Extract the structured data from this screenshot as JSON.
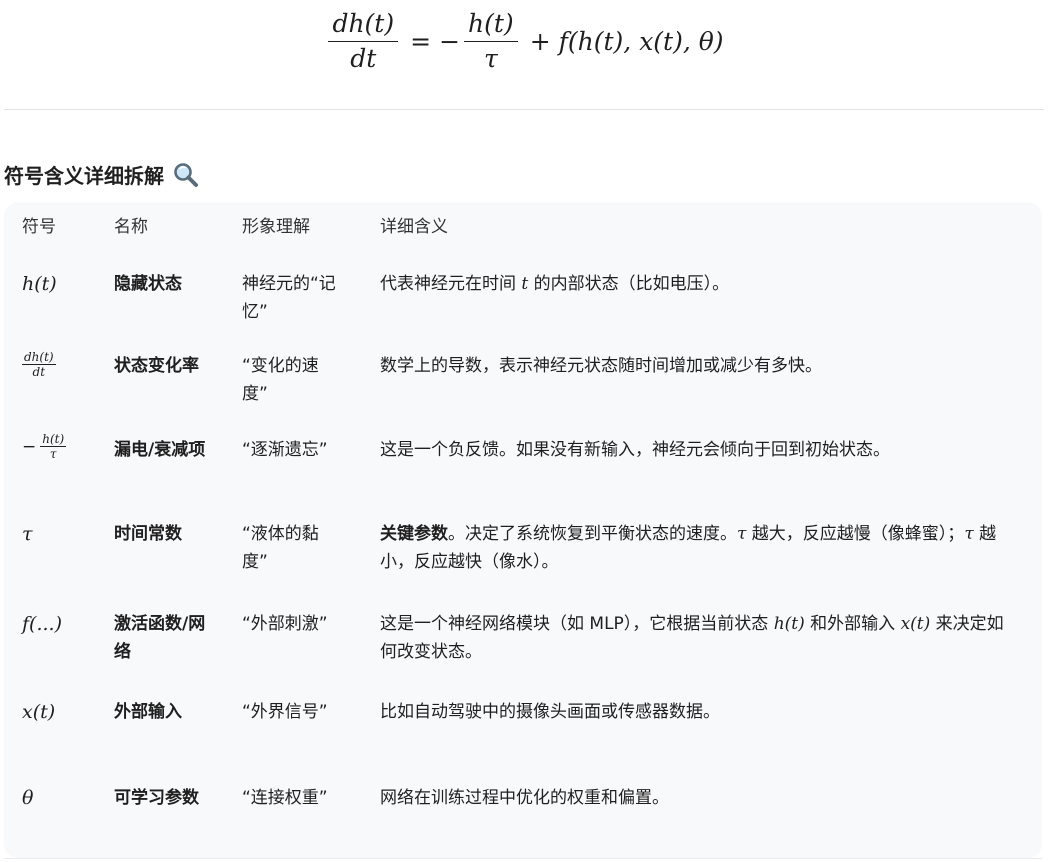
{
  "equation": {
    "lhs_num": "dh(t)",
    "lhs_den": "dt",
    "equals": "=",
    "minus": "−",
    "frac2_num": "h(t)",
    "frac2_den": "τ",
    "plus": "+",
    "rhs": "f(h(t), x(t), θ)"
  },
  "section": {
    "heading": "符号含义详细拆解",
    "icon": "magnifier-icon"
  },
  "table": {
    "headers": [
      "符号",
      "名称",
      "形象理解",
      "详细含义"
    ],
    "rows": [
      {
        "symbol": "h(t)",
        "name": "隐藏状态",
        "image": "神经元的“记忆”",
        "detail": {
          "a": "代表神经元在时间 ",
          "b": "t",
          "c": " 的内部状态（比如电压）。"
        }
      },
      {
        "symbol_num": "dh(t)",
        "symbol_den": "dt",
        "name": "状态变化率",
        "image": "“变化的速度”",
        "detail": "数学上的导数，表示神经元状态随时间增加或减少有多快。"
      },
      {
        "symbol_minus": "−",
        "symbol_num": "h(t)",
        "symbol_den": "τ",
        "name": "漏电/衰减项",
        "image": "“逐渐遗忘”",
        "detail": "这是一个负反馈。如果没有新输入，神经元会倾向于回到初始状态。"
      },
      {
        "symbol": "τ",
        "name": "时间常数",
        "image": "“液体的黏度”",
        "detail": {
          "kw": "关键参数",
          "a": "。决定了系统恢复到平衡状态的速度。",
          "b": "τ",
          "c": " 越大，反应越慢（像蜂蜜）；",
          "d": "τ",
          "e": " 越小，反应越快（像水）。"
        }
      },
      {
        "symbol": "f(...)",
        "name": "激活函数/网络",
        "image": "“外部刺激”",
        "detail": {
          "a": "这是一个神经网络模块（如 MLP），它根据当前状态 ",
          "b": "h(t)",
          "c": " 和外部输入 ",
          "d": "x(t)",
          "e": " 来决定如何改变状态。"
        }
      },
      {
        "symbol": "x(t)",
        "name": "外部输入",
        "image": "“外界信号”",
        "detail": "比如自动驾驶中的摄像头画面或传感器数据。"
      },
      {
        "symbol": "θ",
        "name": "可学习参数",
        "image": "“连接权重”",
        "detail": "网络在训练过程中优化的权重和偏置。"
      }
    ]
  },
  "colors": {
    "text": "#1f1f1f",
    "card_bg": "#f8f9fb",
    "divider": "#e3e3e3"
  }
}
